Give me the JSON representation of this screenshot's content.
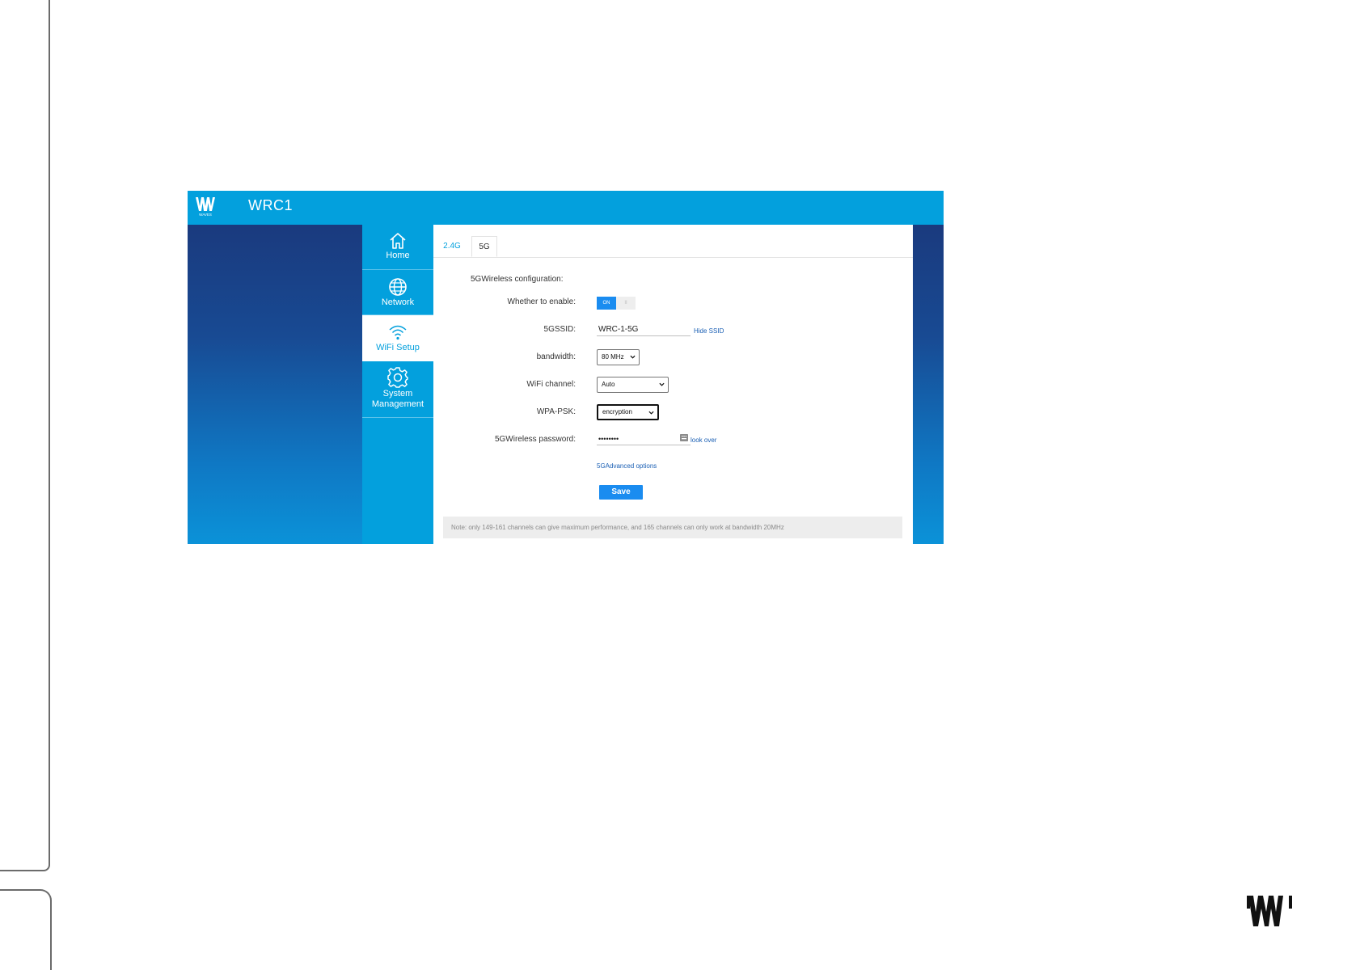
{
  "app": {
    "title": "WRC1",
    "logo_caption": "WAVES"
  },
  "nav": {
    "items": [
      {
        "label": "Home",
        "icon": "home-icon"
      },
      {
        "label": "Network",
        "icon": "globe-icon"
      },
      {
        "label": "WiFi Setup",
        "icon": "wifi-icon",
        "active": true
      },
      {
        "label_line1": "System",
        "label_line2": "Management",
        "icon": "gear-icon"
      }
    ]
  },
  "tabs": [
    {
      "label": "2.4G"
    },
    {
      "label": "5G",
      "active": true
    }
  ],
  "form": {
    "section_title": "5GWireless configuration:",
    "enable": {
      "label": "Whether to enable:",
      "on_label": "ON",
      "off_label": "II"
    },
    "ssid": {
      "label": "5GSSID:",
      "value": "WRC-1-5G",
      "hide_link": "Hide SSID"
    },
    "bandwidth": {
      "label": "bandwidth:",
      "value": "80 MHz"
    },
    "channel": {
      "label": "WiFi channel:",
      "value": "Auto"
    },
    "wpa": {
      "label": "WPA-PSK:",
      "value": "encryption"
    },
    "password": {
      "label": "5GWireless password:",
      "value": "••••••••",
      "look_over": "look over"
    },
    "advanced_link": "5GAdvanced options",
    "save_label": "Save"
  },
  "note": "Note: only 149-161 channels can give maximum performance, and 165 channels can only work at bandwidth 20MHz",
  "colors": {
    "brand_blue": "#03a0dd",
    "accent_blue": "#1a8cf0",
    "sidebar_dark": "#1a3a7e"
  }
}
